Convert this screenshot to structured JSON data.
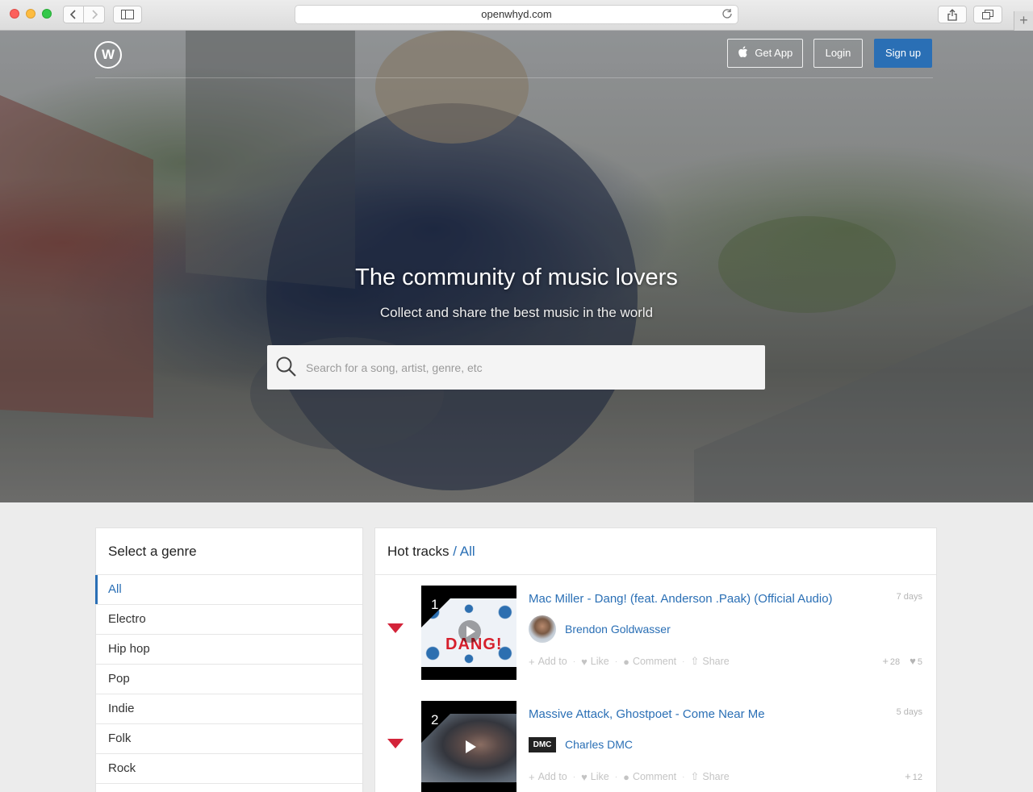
{
  "browser": {
    "url": "openwhyd.com"
  },
  "header": {
    "logo_letter": "W",
    "get_app_label": "Get App",
    "login_label": "Login",
    "signup_label": "Sign up"
  },
  "hero": {
    "title": "The community of music lovers",
    "subtitle": "Collect and share the best music in the world",
    "search_placeholder": "Search for a song, artist, genre, etc"
  },
  "genres": {
    "title": "Select a genre",
    "items": [
      {
        "label": "All",
        "active": true
      },
      {
        "label": "Electro"
      },
      {
        "label": "Hip hop"
      },
      {
        "label": "Pop"
      },
      {
        "label": "Indie"
      },
      {
        "label": "Folk"
      },
      {
        "label": "Rock"
      }
    ]
  },
  "hot_tracks": {
    "title": "Hot tracks",
    "separator": " / All",
    "actions": {
      "add": "Add to",
      "like": "Like",
      "comment": "Comment",
      "share": "Share"
    },
    "tracks": [
      {
        "rank": "1",
        "title": "Mac Miller - Dang! (feat. Anderson .Paak) (Official Audio)",
        "age": "7 days",
        "user": "Brendon Goldwasser",
        "thumb_text": "DANG!",
        "adds": "28",
        "likes": "5"
      },
      {
        "rank": "2",
        "title": "Massive Attack, Ghostpoet - Come Near Me",
        "age": "5 days",
        "user": "Charles DMC",
        "avatar_text": "DMC",
        "adds": "12"
      }
    ]
  },
  "colors": {
    "accent": "#2a6fb5",
    "arrow_red": "#d3243a"
  }
}
